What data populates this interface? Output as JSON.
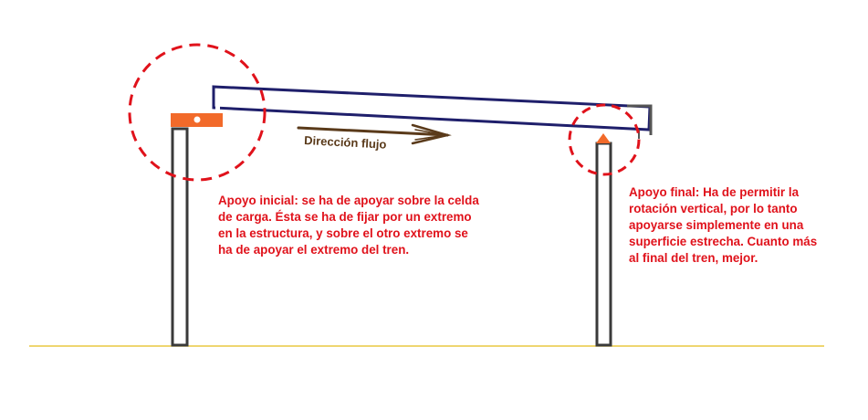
{
  "labels": {
    "flow_direction": "Dirección flujo",
    "start_support": "Apoyo inicial: se ha de apoyar sobre la celda de carga. Ésta se ha de fijar por un extremo en la estructura, y sobre el otro extremo se ha de apoyar el extremo del tren.",
    "end_support": "Apoyo final: Ha de permitir la rotación vertical, por lo tanto apoyarse simplemente en una superficie estrecha. Cuanto más al final del tren, mejor."
  },
  "colors": {
    "beam": "#1f1f6b",
    "post": "#3a3a3a",
    "support_orange": "#f26a2a",
    "annotation_red": "#e0121b",
    "arrow_brown": "#5a3a1a",
    "ground": "#e8c840"
  }
}
